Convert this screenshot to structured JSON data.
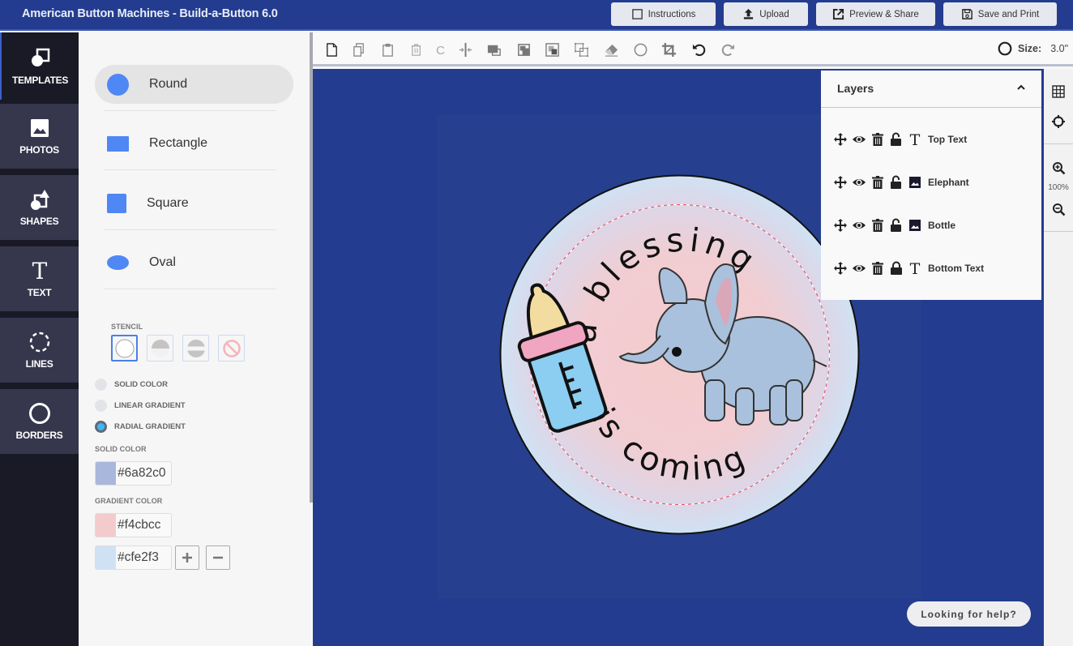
{
  "app": {
    "title": "American Button Machines - Build-a-Button 6.0"
  },
  "topbar": {
    "instructions": "Instructions",
    "upload": "Upload",
    "preview_share": "Preview & Share",
    "save_print": "Save and Print"
  },
  "nav": {
    "items": [
      {
        "label": "TEMPLATES",
        "icon": "templates-icon",
        "active": true
      },
      {
        "label": "PHOTOS",
        "icon": "photo-icon"
      },
      {
        "label": "SHAPES",
        "icon": "shapes-icon"
      },
      {
        "label": "TEXT",
        "icon": "text-icon"
      },
      {
        "label": "LINES",
        "icon": "dashed-circle-icon"
      },
      {
        "label": "BORDERS",
        "icon": "circle-border-icon"
      }
    ]
  },
  "templates": {
    "shapes": [
      {
        "label": "Round",
        "selected": true
      },
      {
        "label": "Rectangle"
      },
      {
        "label": "Square"
      },
      {
        "label": "Oval"
      }
    ],
    "shape_color": "#4f88f5",
    "stencil_label": "STENCIL",
    "stencil_options": [
      "full-circle",
      "top-half",
      "middle-band",
      "none"
    ],
    "fill_modes": [
      {
        "label": "SOLID COLOR",
        "selected": false
      },
      {
        "label": "LINEAR GRADIENT",
        "selected": false
      },
      {
        "label": "RADIAL GRADIENT",
        "selected": true
      }
    ],
    "solid_color_label": "SOLID COLOR",
    "solid_color": "#6a82c0",
    "solid_color_swatch": "#aab7dc",
    "gradient_color_label": "GRADIENT COLOR",
    "gradient_colors": [
      {
        "value": "#f4cbcc",
        "swatch": "#f4cbcc"
      },
      {
        "value": "#cfe2f3",
        "swatch": "#cfe2f3"
      }
    ]
  },
  "toolbar": {
    "tools": [
      "new-page-icon",
      "duplicate-icon",
      "paste-icon",
      "delete-icon",
      "clear-icon",
      "center-icon",
      "send-back-icon",
      "bring-forward-icon",
      "bring-front-icon",
      "group-icon",
      "eraser-icon",
      "circle-crop-icon",
      "crop-icon",
      "undo-icon",
      "redo-icon"
    ],
    "size_label": "Size:",
    "size_value": "3.0\""
  },
  "right_rail": {
    "zoom": "100%"
  },
  "layers": {
    "title": "Layers",
    "items": [
      {
        "name": "Top Text",
        "type": "text",
        "locked": false
      },
      {
        "name": "Elephant",
        "type": "image",
        "locked": false
      },
      {
        "name": "Bottle",
        "type": "image",
        "locked": false
      },
      {
        "name": "Bottom Text",
        "type": "text",
        "locked": true
      }
    ]
  },
  "button_design": {
    "top_text": "a blessing",
    "bottom_text": "is coming",
    "outer_color": "#cfe2f3",
    "inner_color": "#f4cbcc"
  },
  "help": {
    "label": "Looking for help?"
  },
  "colors": {
    "brand": "#233c8f",
    "nav_bg": "#191a25",
    "nav_item": "#36364d",
    "accent": "#4f88f5"
  }
}
